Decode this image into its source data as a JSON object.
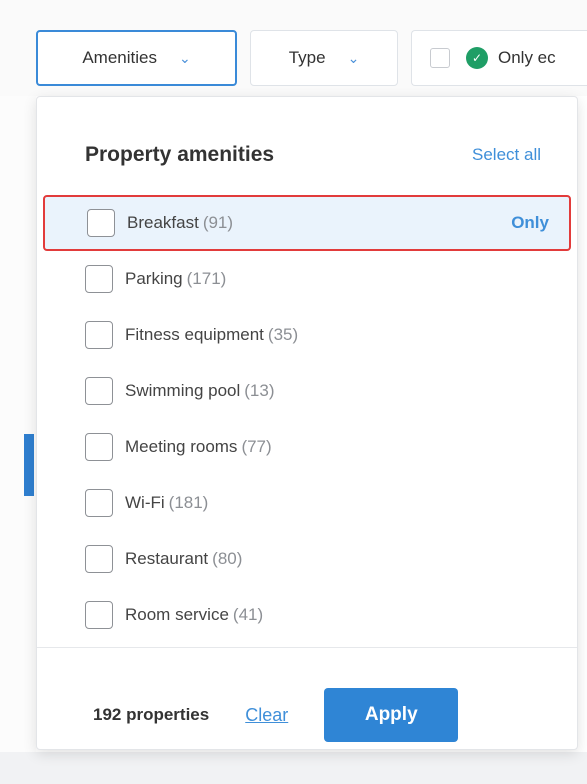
{
  "filters": {
    "amenities_label": "Amenities",
    "type_label": "Type",
    "only_eco_label": "Only ec"
  },
  "panel": {
    "title": "Property amenities",
    "select_all": "Select all",
    "only_link": "Only",
    "options": [
      {
        "label": "Breakfast",
        "count": "(91)",
        "checked": false,
        "highlighted": true
      },
      {
        "label": "Parking",
        "count": "(171)",
        "checked": false
      },
      {
        "label": "Fitness equipment",
        "count": "(35)",
        "checked": false
      },
      {
        "label": "Swimming pool",
        "count": "(13)",
        "checked": false
      },
      {
        "label": "Meeting rooms",
        "count": "(77)",
        "checked": false
      },
      {
        "label": "Wi-Fi",
        "count": "(181)",
        "checked": false
      },
      {
        "label": "Restaurant",
        "count": "(80)",
        "checked": false
      },
      {
        "label": "Room service",
        "count": "(41)",
        "checked": false
      }
    ],
    "footer": {
      "count_text": "192 properties",
      "clear_label": "Clear",
      "apply_label": "Apply"
    }
  },
  "colors": {
    "accent": "#2f85d5",
    "highlight_border": "#e23b3b",
    "highlight_bg": "#eaf3fc",
    "eco_green": "#1f9e66"
  }
}
